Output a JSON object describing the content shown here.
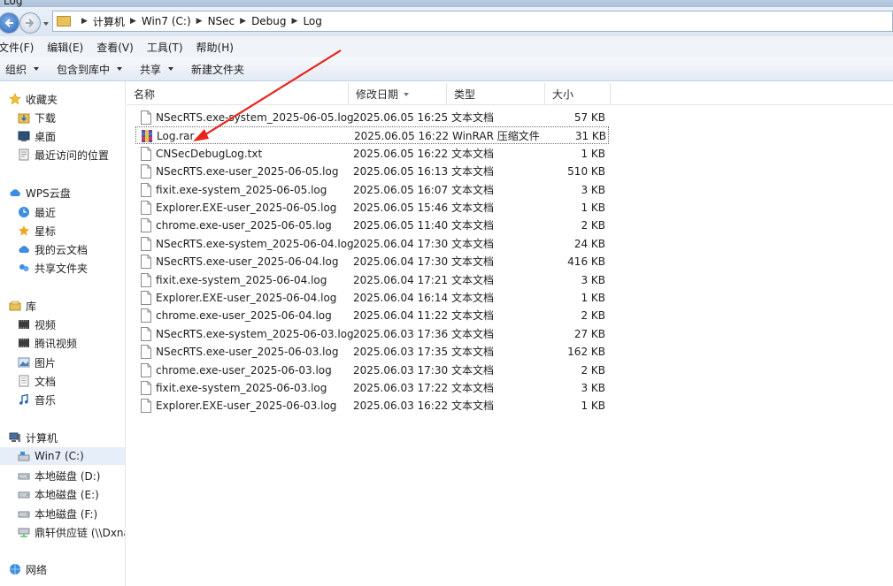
{
  "window": {
    "title": "Log"
  },
  "breadcrumb": [
    "计算机",
    "Win7 (C:)",
    "NSec",
    "Debug",
    "Log"
  ],
  "menu": [
    "文件(F)",
    "编辑(E)",
    "查看(V)",
    "工具(T)",
    "帮助(H)"
  ],
  "toolbar": {
    "organize": "组织",
    "include_library": "包含到库中",
    "share": "共享",
    "new_folder": "新建文件夹"
  },
  "sidebar": {
    "favorites": {
      "label": "收藏夹",
      "items": [
        "下载",
        "桌面",
        "最近访问的位置"
      ]
    },
    "wps": {
      "label": "WPS云盘",
      "items": [
        "最近",
        "星标",
        "我的云文档",
        "共享文件夹"
      ]
    },
    "libraries": {
      "label": "库",
      "items": [
        "视频",
        "腾讯视频",
        "图片",
        "文档",
        "音乐"
      ]
    },
    "computer": {
      "label": "计算机",
      "items": [
        "Win7 (C:)",
        "本地磁盘 (D:)",
        "本地磁盘 (E:)",
        "本地磁盘 (F:)",
        "鼎轩供应链 (\\\\Dxna"
      ]
    },
    "network": {
      "label": "网络"
    }
  },
  "columns": {
    "name": "名称",
    "date": "修改日期",
    "type": "类型",
    "size": "大小"
  },
  "files": [
    {
      "name": "NSecRTS.exe-system_2025-06-05.log",
      "date": "2025.06.05 16:25",
      "type": "文本文档",
      "size": "57 KB",
      "icon": "text-file-icon"
    },
    {
      "name": "Log.rar",
      "date": "2025.06.05 16:22",
      "type": "WinRAR 压缩文件",
      "size": "31 KB",
      "icon": "winrar-archive-icon"
    },
    {
      "name": "CNSecDebugLog.txt",
      "date": "2025.06.05 16:22",
      "type": "文本文档",
      "size": "1 KB",
      "icon": "text-file-icon"
    },
    {
      "name": "NSecRTS.exe-user_2025-06-05.log",
      "date": "2025.06.05 16:13",
      "type": "文本文档",
      "size": "510 KB",
      "icon": "text-file-icon"
    },
    {
      "name": "fixit.exe-system_2025-06-05.log",
      "date": "2025.06.05 16:07",
      "type": "文本文档",
      "size": "3 KB",
      "icon": "text-file-icon"
    },
    {
      "name": "Explorer.EXE-user_2025-06-05.log",
      "date": "2025.06.05 15:46",
      "type": "文本文档",
      "size": "1 KB",
      "icon": "text-file-icon"
    },
    {
      "name": "chrome.exe-user_2025-06-05.log",
      "date": "2025.06.05 11:40",
      "type": "文本文档",
      "size": "2 KB",
      "icon": "text-file-icon"
    },
    {
      "name": "NSecRTS.exe-system_2025-06-04.log",
      "date": "2025.06.04 17:30",
      "type": "文本文档",
      "size": "24 KB",
      "icon": "text-file-icon"
    },
    {
      "name": "NSecRTS.exe-user_2025-06-04.log",
      "date": "2025.06.04 17:30",
      "type": "文本文档",
      "size": "416 KB",
      "icon": "text-file-icon"
    },
    {
      "name": "fixit.exe-system_2025-06-04.log",
      "date": "2025.06.04 17:21",
      "type": "文本文档",
      "size": "3 KB",
      "icon": "text-file-icon"
    },
    {
      "name": "Explorer.EXE-user_2025-06-04.log",
      "date": "2025.06.04 16:14",
      "type": "文本文档",
      "size": "1 KB",
      "icon": "text-file-icon"
    },
    {
      "name": "chrome.exe-user_2025-06-04.log",
      "date": "2025.06.04 11:22",
      "type": "文本文档",
      "size": "2 KB",
      "icon": "text-file-icon"
    },
    {
      "name": "NSecRTS.exe-system_2025-06-03.log",
      "date": "2025.06.03 17:36",
      "type": "文本文档",
      "size": "27 KB",
      "icon": "text-file-icon"
    },
    {
      "name": "NSecRTS.exe-user_2025-06-03.log",
      "date": "2025.06.03 17:35",
      "type": "文本文档",
      "size": "162 KB",
      "icon": "text-file-icon"
    },
    {
      "name": "chrome.exe-user_2025-06-03.log",
      "date": "2025.06.03 17:30",
      "type": "文本文档",
      "size": "2 KB",
      "icon": "text-file-icon"
    },
    {
      "name": "fixit.exe-system_2025-06-03.log",
      "date": "2025.06.03 17:22",
      "type": "文本文档",
      "size": "3 KB",
      "icon": "text-file-icon"
    },
    {
      "name": "Explorer.EXE-user_2025-06-03.log",
      "date": "2025.06.03 16:22",
      "type": "文本文档",
      "size": "1 KB",
      "icon": "text-file-icon"
    }
  ],
  "focused_file": "Log.rar",
  "annotation": {
    "type": "red-arrow",
    "color": "#e8231b",
    "points_to": "Log.rar"
  },
  "colors": {
    "accent": "#2a64b5",
    "selection": "#e5eef9",
    "folder": "#e8c15a"
  }
}
